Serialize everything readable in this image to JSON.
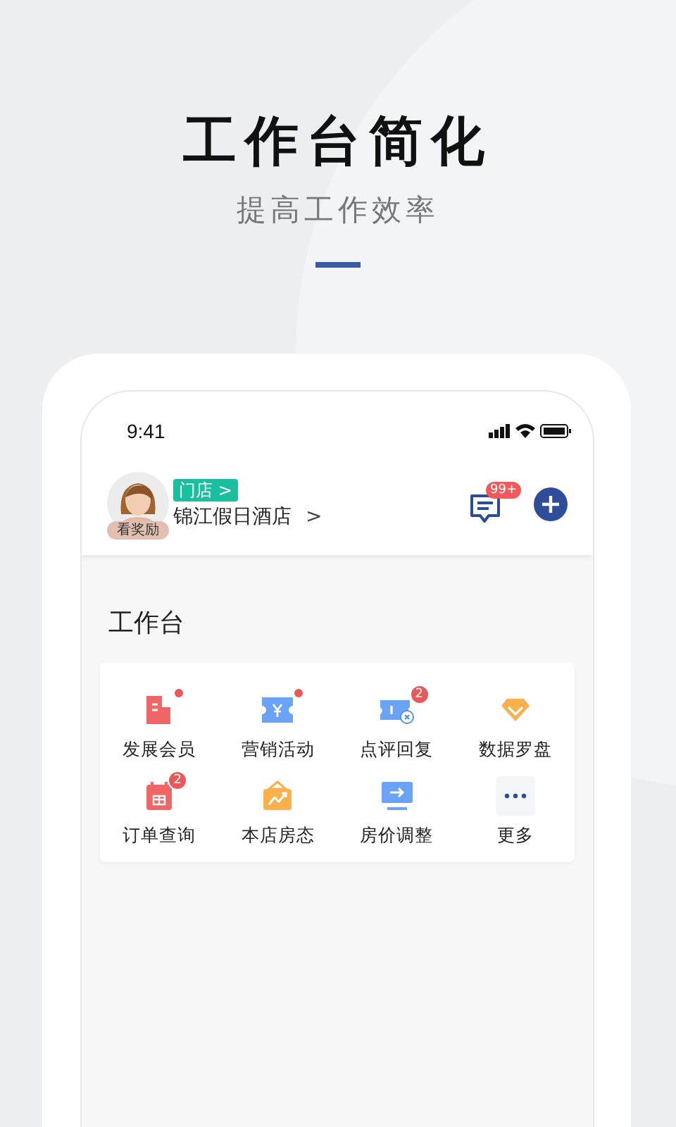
{
  "headline": {
    "title": "工作台简化",
    "subtitle": "提高工作效率"
  },
  "phone": {
    "status_bar": {
      "time": "9:41"
    },
    "header": {
      "avatar_label": "看奖励",
      "store_tag": "门店 >",
      "store_name": "锦江假日酒店",
      "store_arrow": ">",
      "message_badge": "99+"
    },
    "section_title": "工作台",
    "items": [
      {
        "label": "发展会员",
        "dot": true
      },
      {
        "label": "营销活动",
        "dot": true
      },
      {
        "label": "点评回复",
        "dot": false,
        "count": "2"
      },
      {
        "label": "数据罗盘",
        "dot": false
      },
      {
        "label": "订单查询",
        "dot": false,
        "count": "2"
      },
      {
        "label": "本店房态",
        "dot": false
      },
      {
        "label": "房价调整",
        "dot": false
      },
      {
        "label": "更多",
        "dot": false
      }
    ]
  }
}
